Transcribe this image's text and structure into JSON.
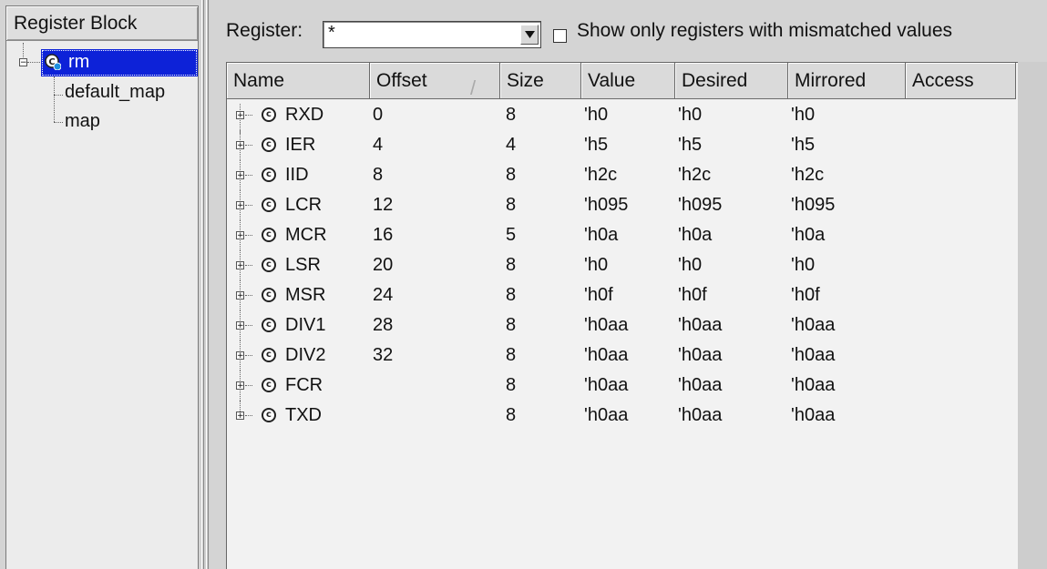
{
  "tree": {
    "header": "Register Block",
    "root": {
      "label": "rm",
      "expander": "−",
      "icon": "register-model-icon"
    },
    "children": [
      {
        "label": "default_map"
      },
      {
        "label": "map"
      }
    ]
  },
  "filter": {
    "register_label": "Register:",
    "register_value": "*",
    "mismatch_label": "Show only registers with mismatched values",
    "mismatch_checked": false
  },
  "table": {
    "columns": [
      "Name",
      "Offset",
      "Size",
      "Value",
      "Desired",
      "Mirrored",
      "Access"
    ],
    "sort_indicator": "/",
    "rows": [
      {
        "name": "RXD",
        "offset": "0",
        "size": "8",
        "value": "'h0",
        "desired": "'h0",
        "mirrored": "'h0",
        "access": ""
      },
      {
        "name": "IER",
        "offset": "4",
        "size": "4",
        "value": "'h5",
        "desired": "'h5",
        "mirrored": "'h5",
        "access": ""
      },
      {
        "name": "IID",
        "offset": "8",
        "size": "8",
        "value": "'h2c",
        "desired": "'h2c",
        "mirrored": "'h2c",
        "access": ""
      },
      {
        "name": "LCR",
        "offset": "12",
        "size": "8",
        "value": "'h095",
        "desired": "'h095",
        "mirrored": "'h095",
        "access": ""
      },
      {
        "name": "MCR",
        "offset": "16",
        "size": "5",
        "value": "'h0a",
        "desired": "'h0a",
        "mirrored": "'h0a",
        "access": ""
      },
      {
        "name": "LSR",
        "offset": "20",
        "size": "8",
        "value": "'h0",
        "desired": "'h0",
        "mirrored": "'h0",
        "access": ""
      },
      {
        "name": "MSR",
        "offset": "24",
        "size": "8",
        "value": "'h0f",
        "desired": "'h0f",
        "mirrored": "'h0f",
        "access": ""
      },
      {
        "name": "DIV1",
        "offset": "28",
        "size": "8",
        "value": "'h0aa",
        "desired": "'h0aa",
        "mirrored": "'h0aa",
        "access": ""
      },
      {
        "name": "DIV2",
        "offset": "32",
        "size": "8",
        "value": "'h0aa",
        "desired": "'h0aa",
        "mirrored": "'h0aa",
        "access": ""
      },
      {
        "name": "FCR",
        "offset": "",
        "size": "8",
        "value": "'h0aa",
        "desired": "'h0aa",
        "mirrored": "'h0aa",
        "access": ""
      },
      {
        "name": "TXD",
        "offset": "",
        "size": "8",
        "value": "'h0aa",
        "desired": "'h0aa",
        "mirrored": "'h0aa",
        "access": ""
      }
    ],
    "row_icon": "class-c-icon",
    "row_expander": "+"
  },
  "colors": {
    "selection": "#0d22d8",
    "window_bg": "#d4d4d4",
    "table_bg": "#f2f2f2"
  }
}
